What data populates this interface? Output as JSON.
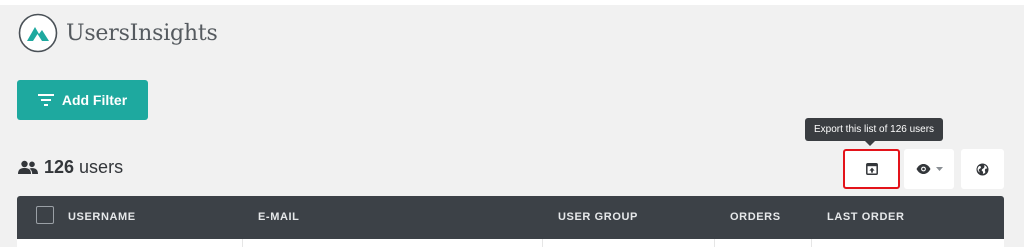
{
  "app": {
    "brand_name": "UsersInsights"
  },
  "toolbar": {
    "add_filter_label": "Add Filter",
    "export_tooltip": "Export this list of 126 users",
    "export_icon": "export-icon",
    "visibility_icon": "eye-icon",
    "globe_icon": "globe-icon"
  },
  "summary": {
    "count": "126",
    "label": "users",
    "icon": "users-icon"
  },
  "table": {
    "columns": [
      "USERNAME",
      "E-MAIL",
      "USER GROUP",
      "ORDERS",
      "LAST ORDER"
    ]
  },
  "colors": {
    "accent": "#1ea99f",
    "header_bg": "#3c4147",
    "highlight": "#e3131a"
  }
}
